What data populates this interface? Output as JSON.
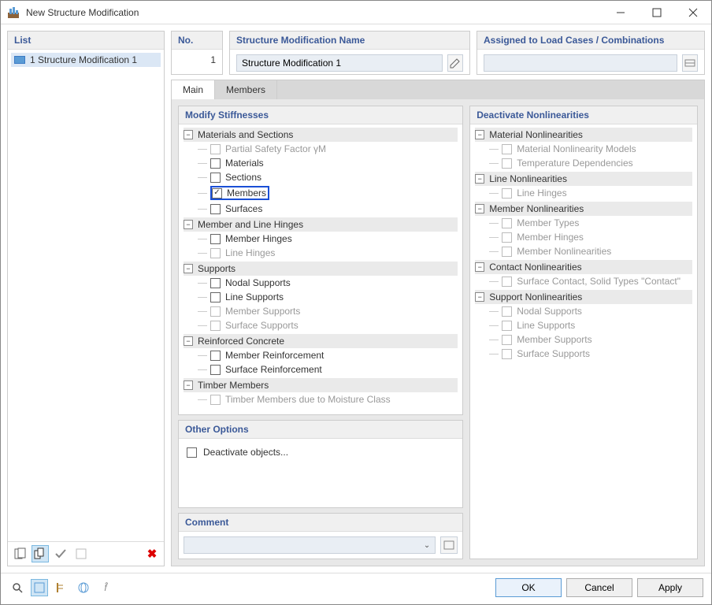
{
  "window": {
    "title": "New Structure Modification"
  },
  "list": {
    "header": "List",
    "items": [
      "1 Structure Modification 1"
    ]
  },
  "no": {
    "header": "No.",
    "value": "1"
  },
  "name": {
    "header": "Structure Modification Name",
    "value": "Structure Modification 1"
  },
  "assigned": {
    "header": "Assigned to Load Cases / Combinations",
    "value": ""
  },
  "tabs": {
    "main": "Main",
    "members": "Members"
  },
  "modify": {
    "title": "Modify Stiffnesses",
    "g1": {
      "label": "Materials and Sections",
      "items": [
        {
          "label": "Partial Safety Factor γM",
          "checked": false,
          "disabled": true
        },
        {
          "label": "Materials",
          "checked": false,
          "disabled": false
        },
        {
          "label": "Sections",
          "checked": false,
          "disabled": false
        },
        {
          "label": "Members",
          "checked": true,
          "disabled": false,
          "highlighted": true
        },
        {
          "label": "Surfaces",
          "checked": false,
          "disabled": false
        }
      ]
    },
    "g2": {
      "label": "Member and Line Hinges",
      "items": [
        {
          "label": "Member Hinges",
          "checked": false,
          "disabled": false
        },
        {
          "label": "Line Hinges",
          "checked": false,
          "disabled": true
        }
      ]
    },
    "g3": {
      "label": "Supports",
      "items": [
        {
          "label": "Nodal Supports",
          "checked": false,
          "disabled": false
        },
        {
          "label": "Line Supports",
          "checked": false,
          "disabled": false
        },
        {
          "label": "Member Supports",
          "checked": false,
          "disabled": true
        },
        {
          "label": "Surface Supports",
          "checked": false,
          "disabled": true
        }
      ]
    },
    "g4": {
      "label": "Reinforced Concrete",
      "items": [
        {
          "label": "Member Reinforcement",
          "checked": false,
          "disabled": false
        },
        {
          "label": "Surface Reinforcement",
          "checked": false,
          "disabled": false
        }
      ]
    },
    "g5": {
      "label": "Timber Members",
      "items": [
        {
          "label": "Timber Members due to Moisture Class",
          "checked": false,
          "disabled": true
        }
      ]
    }
  },
  "deactivate": {
    "title": "Deactivate Nonlinearities",
    "g1": {
      "label": "Material Nonlinearities",
      "items": [
        {
          "label": "Material Nonlinearity Models",
          "disabled": true
        },
        {
          "label": "Temperature Dependencies",
          "disabled": true
        }
      ]
    },
    "g2": {
      "label": "Line Nonlinearities",
      "items": [
        {
          "label": "Line Hinges",
          "disabled": true
        }
      ]
    },
    "g3": {
      "label": "Member Nonlinearities",
      "items": [
        {
          "label": "Member Types",
          "disabled": true
        },
        {
          "label": "Member Hinges",
          "disabled": true
        },
        {
          "label": "Member Nonlinearities",
          "disabled": true
        }
      ]
    },
    "g4": {
      "label": "Contact Nonlinearities",
      "items": [
        {
          "label": "Surface Contact, Solid Types \"Contact\"",
          "disabled": true
        }
      ]
    },
    "g5": {
      "label": "Support Nonlinearities",
      "items": [
        {
          "label": "Nodal Supports",
          "disabled": true
        },
        {
          "label": "Line Supports",
          "disabled": true
        },
        {
          "label": "Member Supports",
          "disabled": true
        },
        {
          "label": "Surface Supports",
          "disabled": true
        }
      ]
    }
  },
  "other": {
    "title": "Other Options",
    "deactivate_objects": "Deactivate objects..."
  },
  "comment": {
    "title": "Comment"
  },
  "buttons": {
    "ok": "OK",
    "cancel": "Cancel",
    "apply": "Apply"
  }
}
